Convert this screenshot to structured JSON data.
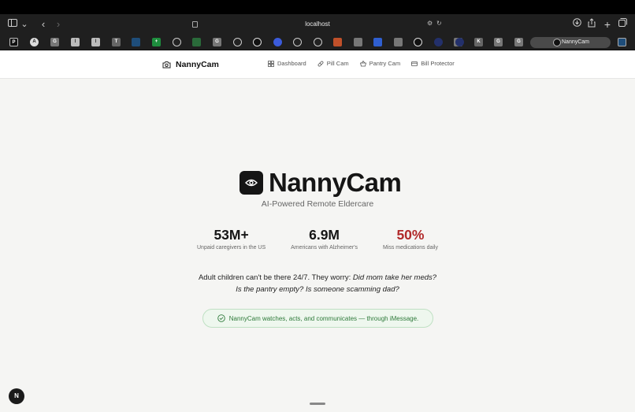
{
  "browser": {
    "url": "localhost",
    "active_tab_title": "NannyCam",
    "favorites": [
      "P",
      "A",
      "G",
      "I",
      "I",
      "T",
      "",
      "+",
      "",
      "",
      "",
      "G",
      "",
      "",
      "",
      "",
      "",
      "",
      "",
      "",
      "",
      "",
      "G",
      "",
      "",
      "",
      "",
      "",
      "K",
      "G",
      "G"
    ],
    "colors": {
      "chrome_bg": "#1f1f1f",
      "menubar_bg": "#000000"
    }
  },
  "header": {
    "brand": "NannyCam",
    "nav": [
      {
        "label": "Dashboard",
        "icon": "grid-icon"
      },
      {
        "label": "Pill Cam",
        "icon": "pill-icon"
      },
      {
        "label": "Pantry Cam",
        "icon": "basket-icon"
      },
      {
        "label": "Bill Protector",
        "icon": "card-icon"
      }
    ]
  },
  "hero": {
    "title": "NannyCam",
    "tagline": "AI-Powered Remote Eldercare",
    "stats": [
      {
        "value": "53M+",
        "label": "Unpaid caregivers in the US",
        "highlight": false
      },
      {
        "value": "6.9M",
        "label": "Americans with Alzheimer's",
        "highlight": false
      },
      {
        "value": "50%",
        "label": "Miss medications daily",
        "highlight": true
      }
    ],
    "pitch": {
      "lead": "Adult children can't be there 24/7. They worry: ",
      "q1": "Did mom take her meds?",
      "q2": "Is the pantry empty? Is someone scamming dad?"
    },
    "callout": "NannyCam watches, acts, and communicates — through iMessage."
  },
  "corner_badge": "N",
  "colors": {
    "accent_red": "#b12a2a",
    "success_green": "#2e7a3a",
    "page_bg": "#f5f5f3"
  }
}
